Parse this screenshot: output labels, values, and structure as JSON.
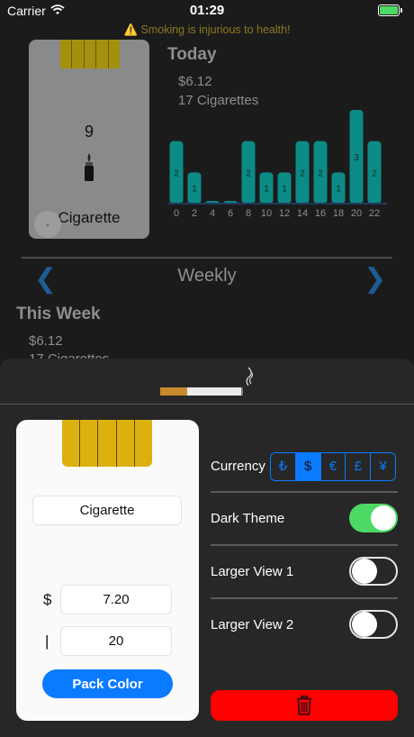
{
  "status": {
    "carrier": "Carrier",
    "time": "01:29"
  },
  "warning": "Smoking is injurious to health!",
  "top_card": {
    "count": "9",
    "name": "Cigarette",
    "minus": "-"
  },
  "today": {
    "title": "Today",
    "money": "$6.12",
    "cigs": "17 Cigarettes"
  },
  "chart_data": {
    "type": "bar",
    "categories": [
      "0",
      "2",
      "4",
      "6",
      "8",
      "10",
      "12",
      "14",
      "16",
      "18",
      "20",
      "22"
    ],
    "values": [
      2,
      1,
      0,
      0,
      2,
      1,
      1,
      2,
      2,
      1,
      3,
      2
    ],
    "bar_color": "#0c8a85",
    "ylim": [
      0,
      3
    ]
  },
  "period": {
    "label": "Weekly"
  },
  "week": {
    "title": "This Week",
    "money": "$6.12",
    "cigs": "17 Cigarettes"
  },
  "settings": {
    "name_value": "Cigarette",
    "price_symbol": "$",
    "price_value": "7.20",
    "count_symbol": "|",
    "count_value": "20",
    "pack_color_label": "Pack Color",
    "pack_color": "#dcb10e",
    "currency_label": "Currency",
    "currencies": [
      "₺",
      "$",
      "€",
      "£",
      "¥"
    ],
    "selected_currency": "$",
    "dark_theme_label": "Dark Theme",
    "dark_theme_on": true,
    "larger_view1_label": "Larger View 1",
    "larger_view1_on": false,
    "larger_view2_label": "Larger View 2",
    "larger_view2_on": false,
    "delete_icon": "trash-icon",
    "delete_color": "#ff0000"
  }
}
